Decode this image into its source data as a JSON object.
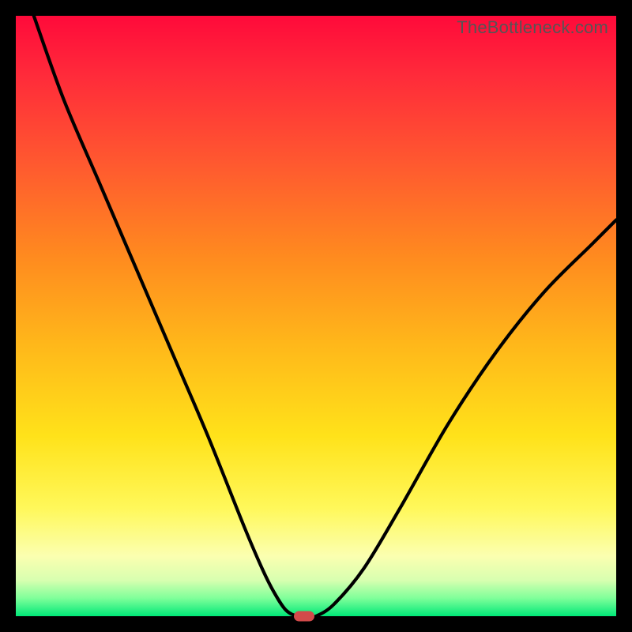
{
  "watermark": "TheBottleneck.com",
  "colors": {
    "frame": "#000000",
    "curve": "#000000",
    "marker": "#d24a4a",
    "gradient_stops": [
      "#ff0a3a",
      "#ff2b3a",
      "#ff5a2f",
      "#ff8a1f",
      "#ffb81a",
      "#ffe21a",
      "#fff85a",
      "#fbffb0",
      "#d8ffb0",
      "#7fff9a",
      "#00e878"
    ]
  },
  "chart_data": {
    "type": "line",
    "title": "",
    "xlabel": "",
    "ylabel": "",
    "xlim": [
      0,
      100
    ],
    "ylim": [
      0,
      100
    ],
    "grid": false,
    "legend": false,
    "series": [
      {
        "name": "bottleneck-curve",
        "x": [
          3,
          8,
          14,
          20,
          26,
          32,
          38,
          41,
          43,
          45,
          47,
          49,
          50,
          53,
          58,
          64,
          72,
          80,
          88,
          96,
          100
        ],
        "y": [
          100,
          86,
          72,
          58,
          44,
          30,
          15,
          8,
          4,
          1,
          0,
          0,
          0,
          2,
          8,
          18,
          32,
          44,
          54,
          62,
          66
        ]
      }
    ],
    "annotations": [
      {
        "name": "optimal-marker",
        "x": 48,
        "y": 0
      }
    ]
  }
}
